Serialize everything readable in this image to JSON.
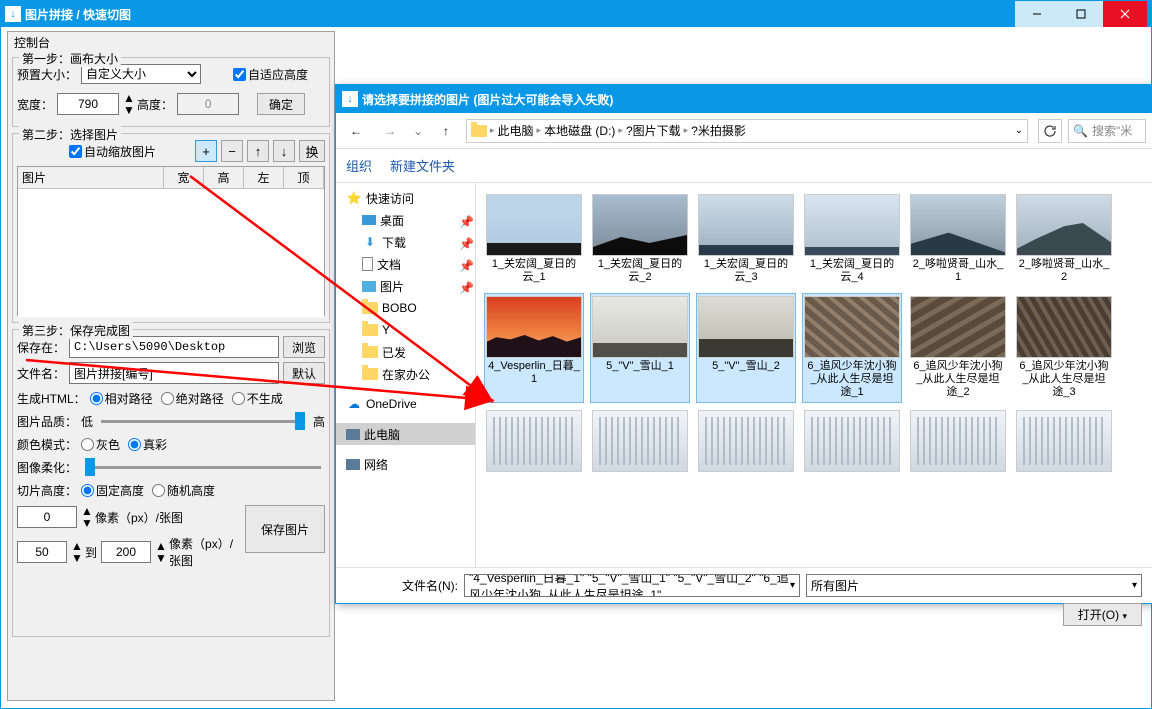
{
  "main_window": {
    "title": "图片拼接 / 快速切图",
    "control_panel_label": "控制台"
  },
  "step1": {
    "legend": "第一步：画布大小",
    "preset_label": "预置大小：",
    "preset_value": "自定义大小",
    "auto_height_label": "自适应高度",
    "auto_height_checked": true,
    "width_label": "宽度：",
    "width_value": "790",
    "height_label": "高度：",
    "height_value": "0",
    "confirm_btn": "确定"
  },
  "step2": {
    "legend": "第二步：选择图片",
    "auto_scale_label": "自动缩放图片",
    "auto_scale_checked": true,
    "btn_plus": "+",
    "btn_minus": "−",
    "btn_up": "↑",
    "btn_down": "↓",
    "btn_swap": "换",
    "headers": {
      "pic": "图片",
      "w": "宽",
      "h": "高",
      "l": "左",
      "t": "顶"
    }
  },
  "step3": {
    "legend": "第三步：保存完成图",
    "save_path_label": "保存在：",
    "save_path": "C:\\Users\\5090\\Desktop",
    "browse_btn": "浏览",
    "filename_label": "文件名：",
    "filename_value": "图片拼接[编号]",
    "default_btn": "默认",
    "gen_html_label": "生成HTML：",
    "gen_html_options": [
      "相对路径",
      "绝对路径",
      "不生成"
    ],
    "gen_html_selected": 0,
    "quality_label": "图片品质：",
    "quality_low": "低",
    "quality_high": "高",
    "color_mode_label": "颜色模式：",
    "color_mode_options": [
      "灰色",
      "真彩"
    ],
    "color_mode_selected": 1,
    "soften_label": "图像柔化：",
    "cut_height_label": "切片高度：",
    "cut_height_options": [
      "固定高度",
      "随机高度"
    ],
    "cut_height_selected": 0,
    "fixed_px_value": "0",
    "fixed_px_suffix": "像素（px）/张图",
    "range_from": "50",
    "range_to_label": "到",
    "range_to": "200",
    "range_suffix": "像素（px）/张图",
    "save_btn": "保存图片"
  },
  "file_dialog": {
    "title": "请选择要拼接的图片 (图片过大可能会导入失败)",
    "breadcrumb": [
      "此电脑",
      "本地磁盘 (D:)",
      "?图片下载",
      "?米拍摄影"
    ],
    "search_placeholder": "搜索\"米",
    "organize_label": "组织",
    "new_folder_label": "新建文件夹",
    "tree": {
      "quick_access": "快速访问",
      "desktop": "桌面",
      "downloads": "下载",
      "documents": "文档",
      "pictures": "图片",
      "sub_bobo": "BOBO",
      "sub_y": "Y",
      "sub_sent": "已发",
      "sub_home": "在家办公",
      "onedrive": "OneDrive",
      "this_pc": "此电脑",
      "network": "网络"
    },
    "files": [
      {
        "name": "1_关宏阔_夏日的云_1",
        "thumb": "sky1",
        "selected": false
      },
      {
        "name": "1_关宏阔_夏日的云_2",
        "thumb": "sky2",
        "selected": false
      },
      {
        "name": "1_关宏阔_夏日的云_3",
        "thumb": "sky3",
        "selected": false
      },
      {
        "name": "1_关宏阔_夏日的云_4",
        "thumb": "sky4",
        "selected": false
      },
      {
        "name": "2_哆啦贤哥_山水_1",
        "thumb": "mount1",
        "selected": false
      },
      {
        "name": "2_哆啦贤哥_山水_2",
        "thumb": "mount2",
        "selected": false
      },
      {
        "name": "4_Vesperlin_日暮_1",
        "thumb": "sunset",
        "selected": true
      },
      {
        "name": "5_\"V\"_雪山_1",
        "thumb": "fog1",
        "selected": true
      },
      {
        "name": "5_\"V\"_雪山_2",
        "thumb": "fog2",
        "selected": true
      },
      {
        "name": "6_追风少年沈小狗_从此人生尽是坦途_1",
        "thumb": "aerial1",
        "selected": true
      },
      {
        "name": "6_追风少年沈小狗_从此人生尽是坦途_2",
        "thumb": "aerial2",
        "selected": false
      },
      {
        "name": "6_追风少年沈小狗_从此人生尽是坦途_3",
        "thumb": "aerial3",
        "selected": false
      },
      {
        "name": "",
        "thumb": "arch",
        "selected": false
      },
      {
        "name": "",
        "thumb": "arch",
        "selected": false
      },
      {
        "name": "",
        "thumb": "arch",
        "selected": false
      },
      {
        "name": "",
        "thumb": "arch",
        "selected": false
      },
      {
        "name": "",
        "thumb": "arch",
        "selected": false
      },
      {
        "name": "",
        "thumb": "arch",
        "selected": false
      }
    ],
    "filename_label": "文件名(N):",
    "filename_value": "\"4_Vesperlin_日暮_1\" \"5_\"V\"_雪山_1\" \"5_\"V\"_雪山_2\" \"6_追风少年沈小狗_从此人生尽是坦途_1\"",
    "filter_value": "所有图片",
    "open_btn": "打开(O)"
  }
}
